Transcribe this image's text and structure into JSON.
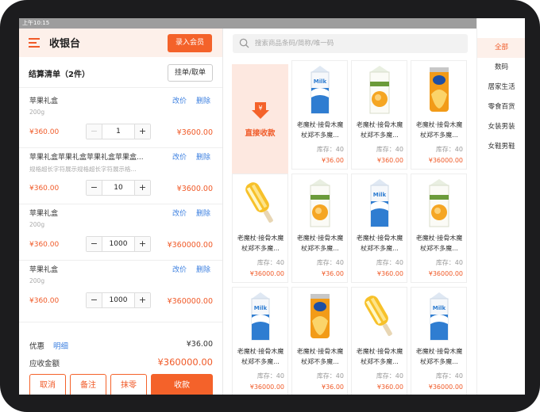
{
  "status_bar": {
    "time": "上午10:15",
    "right": "0.00K/s ⚙ ◈ ▮ 21%"
  },
  "header": {
    "title": "收银台",
    "member_button": "录入会员",
    "menu_icon": "menu-icon"
  },
  "cart": {
    "heading": "结算清单（2件）",
    "hang_button": "挂单/取单",
    "items": [
      {
        "name": "苹果礼盒",
        "spec": "200g",
        "edit": "改价",
        "delete": "删除",
        "price": "¥360.00",
        "qty": "1",
        "total": "¥3600.00",
        "minus_disabled": true
      },
      {
        "name": "苹果礼盒苹果礼盒苹果礼盒苹果盒...",
        "spec": "规格超长字符展示规格超长字符展示格...",
        "edit": "改价",
        "delete": "删除",
        "price": "¥360.00",
        "qty": "10",
        "total": "¥3600.00",
        "minus_disabled": false
      },
      {
        "name": "苹果礼盒",
        "spec": "200g",
        "edit": "改价",
        "delete": "删除",
        "price": "¥360.00",
        "qty": "1000",
        "total": "¥360000.00",
        "minus_disabled": false
      },
      {
        "name": "苹果礼盒",
        "spec": "200g",
        "edit": "改价",
        "delete": "删除",
        "price": "¥360.00",
        "qty": "1000",
        "total": "¥360000.00",
        "minus_disabled": false
      }
    ]
  },
  "summary": {
    "discount_label": "优惠",
    "detail_link": "明细",
    "discount_value": "¥36.00",
    "due_label": "应收金额",
    "due_value": "¥360000.00"
  },
  "actions": {
    "cancel": "取消",
    "note": "备注",
    "round": "抹零",
    "checkout": "收款"
  },
  "search": {
    "placeholder": "搜索商品条码/简称/唯一码"
  },
  "direct_pay": {
    "label": "直接收款"
  },
  "products": [
    {
      "img": "milk",
      "name": "老魔杖·接骨木魔杖郑不多魔...",
      "stock": "库存：40",
      "price": "¥36.00"
    },
    {
      "img": "juice",
      "name": "老魔杖·接骨木魔杖郑不多魔...",
      "stock": "库存：40",
      "price": "¥360.00"
    },
    {
      "img": "chips",
      "name": "老魔杖·接骨木魔杖郑不多魔...",
      "stock": "库存：40",
      "price": "¥36000.00"
    },
    {
      "img": "icecream",
      "name": "老魔杖·接骨木魔杖郑不多魔...",
      "stock": "库存：40",
      "price": "¥36000.00"
    },
    {
      "img": "juice",
      "name": "老魔杖·接骨木魔杖郑不多魔...",
      "stock": "库存：40",
      "price": "¥36.00"
    },
    {
      "img": "milk",
      "name": "老魔杖·接骨木魔杖郑不多魔...",
      "stock": "库存：40",
      "price": "¥360.00"
    },
    {
      "img": "juice",
      "name": "老魔杖·接骨木魔杖郑不多魔...",
      "stock": "库存：40",
      "price": "¥36000.00"
    },
    {
      "img": "milk",
      "name": "老魔杖·接骨木魔杖郑不多魔...",
      "stock": "库存：40",
      "price": "¥36000.00"
    },
    {
      "img": "chips",
      "name": "老魔杖·接骨木魔杖郑不多魔...",
      "stock": "库存：40",
      "price": "¥36.00"
    },
    {
      "img": "icecream",
      "name": "老魔杖·接骨木魔杖郑不多魔...",
      "stock": "库存：40",
      "price": "¥360.00"
    },
    {
      "img": "milk",
      "name": "老魔杖·接骨木魔杖郑不多魔...",
      "stock": "库存：40",
      "price": "¥36000.00"
    }
  ],
  "categories": [
    "全部",
    "数码",
    "居家生活",
    "零食百货",
    "女装男装",
    "女鞋男鞋"
  ],
  "colors": {
    "accent": "#f4622a",
    "link": "#3b7fe0",
    "accent_light": "#fdf0ea"
  }
}
